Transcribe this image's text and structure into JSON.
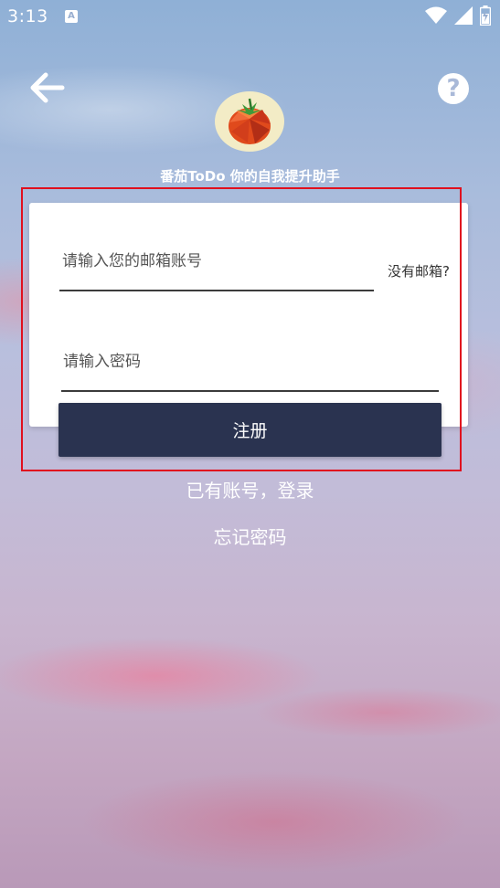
{
  "status_bar": {
    "time": "3:13",
    "notification_icon": "a-icon",
    "icons": [
      "wifi-icon",
      "signal-icon",
      "battery-icon"
    ]
  },
  "header": {
    "back_icon": "arrow-left-icon",
    "help_icon": "question-icon",
    "help_glyph": "?",
    "tagline": "番茄ToDo 你的自我提升助手"
  },
  "form": {
    "email": {
      "placeholder": "请输入您的邮箱账号",
      "value": ""
    },
    "no_email_link": "没有邮箱?",
    "password": {
      "placeholder": "请输入密码",
      "value": ""
    },
    "register_label": "注册"
  },
  "links": {
    "login": "已有账号，登录",
    "forgot_password": "忘记密码"
  },
  "colors": {
    "button_bg": "#2a3350",
    "highlight_border": "#e0101e",
    "card_bg": "#ffffff"
  }
}
